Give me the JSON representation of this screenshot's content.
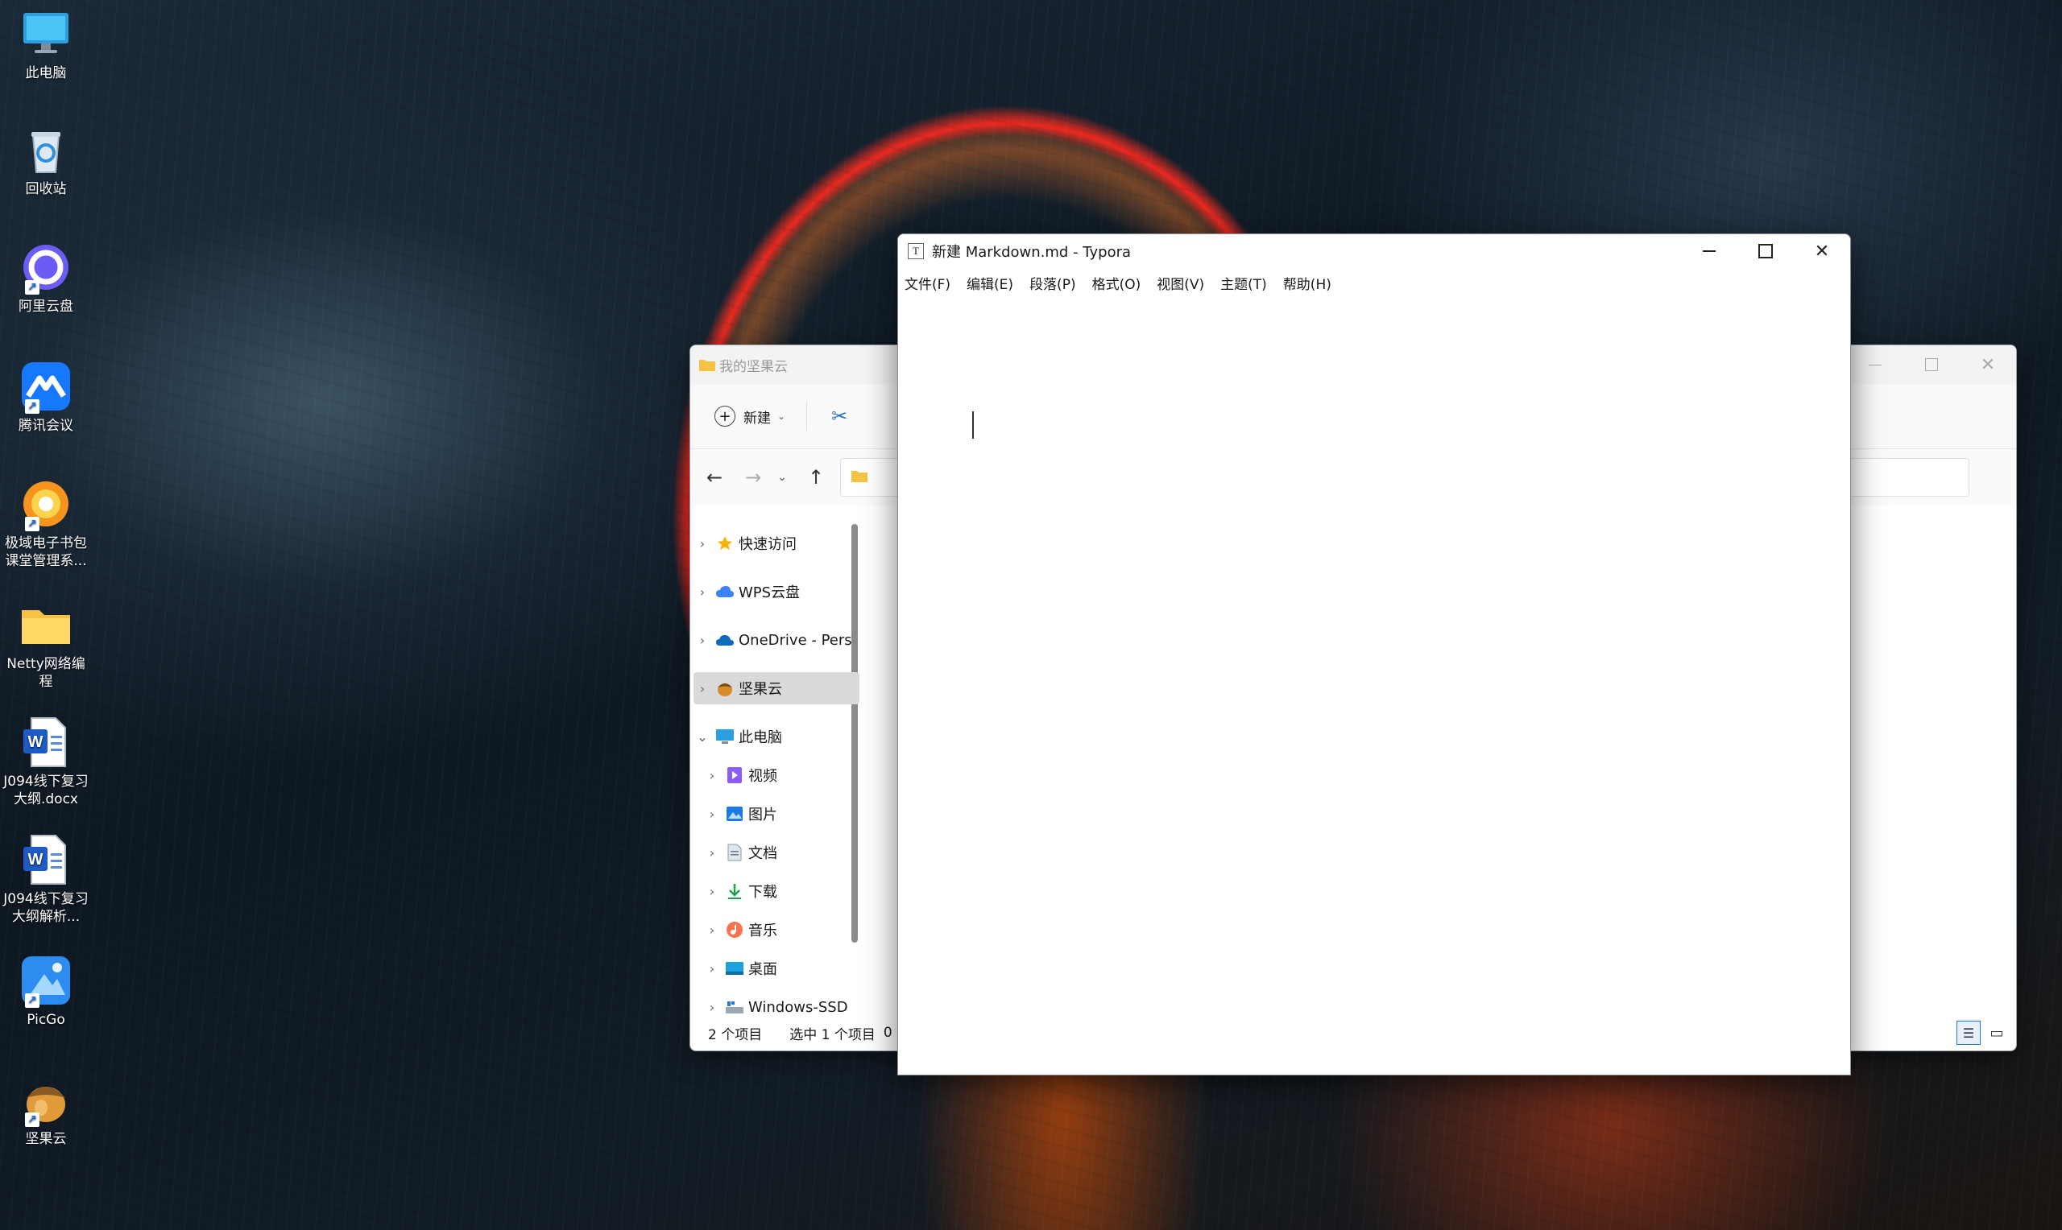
{
  "desktop": {
    "icons": [
      {
        "label": "此电脑",
        "icon": "monitor-icon"
      },
      {
        "label": "回收站",
        "icon": "recycle-bin-icon"
      },
      {
        "label": "阿里云盘",
        "icon": "aliyun-drive-icon"
      },
      {
        "label": "腾讯会议",
        "icon": "tencent-meeting-icon"
      },
      {
        "label": "极域电子书包课堂管理系...",
        "icon": "jiyu-classroom-icon"
      },
      {
        "label": "Netty网络编程",
        "icon": "folder-icon"
      },
      {
        "label": "J094线下复习大纲.docx",
        "icon": "word-doc-icon"
      },
      {
        "label": "J094线下复习大纲解析...",
        "icon": "word-doc-icon"
      },
      {
        "label": "PicGo",
        "icon": "picgo-icon"
      },
      {
        "label": "坚果云",
        "icon": "jianguoyun-icon"
      }
    ]
  },
  "explorer": {
    "title": "我的坚果云",
    "toolbar": {
      "new_label": "新建"
    },
    "nav": [
      {
        "label": "快速访问",
        "icon": "star-icon",
        "expanded": false
      },
      {
        "label": "WPS云盘",
        "icon": "wps-cloud-icon",
        "expanded": false
      },
      {
        "label": "OneDrive - Pers",
        "icon": "onedrive-icon",
        "expanded": false
      },
      {
        "label": "坚果云",
        "icon": "jianguoyun-icon",
        "expanded": false,
        "selected": true
      },
      {
        "label": "此电脑",
        "icon": "monitor-icon",
        "expanded": true
      },
      {
        "label": "视频",
        "icon": "video-icon",
        "expanded": false
      },
      {
        "label": "图片",
        "icon": "picture-icon",
        "expanded": false
      },
      {
        "label": "文档",
        "icon": "document-icon",
        "expanded": false
      },
      {
        "label": "下载",
        "icon": "download-icon",
        "expanded": false
      },
      {
        "label": "音乐",
        "icon": "music-icon",
        "expanded": false
      },
      {
        "label": "桌面",
        "icon": "desktop-icon",
        "expanded": false
      },
      {
        "label": "Windows-SSD",
        "icon": "drive-icon",
        "expanded": false
      }
    ],
    "status": {
      "item_count": "2 个项目",
      "selected": "选中 1 个项目",
      "size": "0"
    }
  },
  "typora": {
    "title": "新建 Markdown.md - Typora",
    "app_icon_letter": "T",
    "menu": [
      "文件(F)",
      "编辑(E)",
      "段落(P)",
      "格式(O)",
      "视图(V)",
      "主题(T)",
      "帮助(H)"
    ]
  }
}
